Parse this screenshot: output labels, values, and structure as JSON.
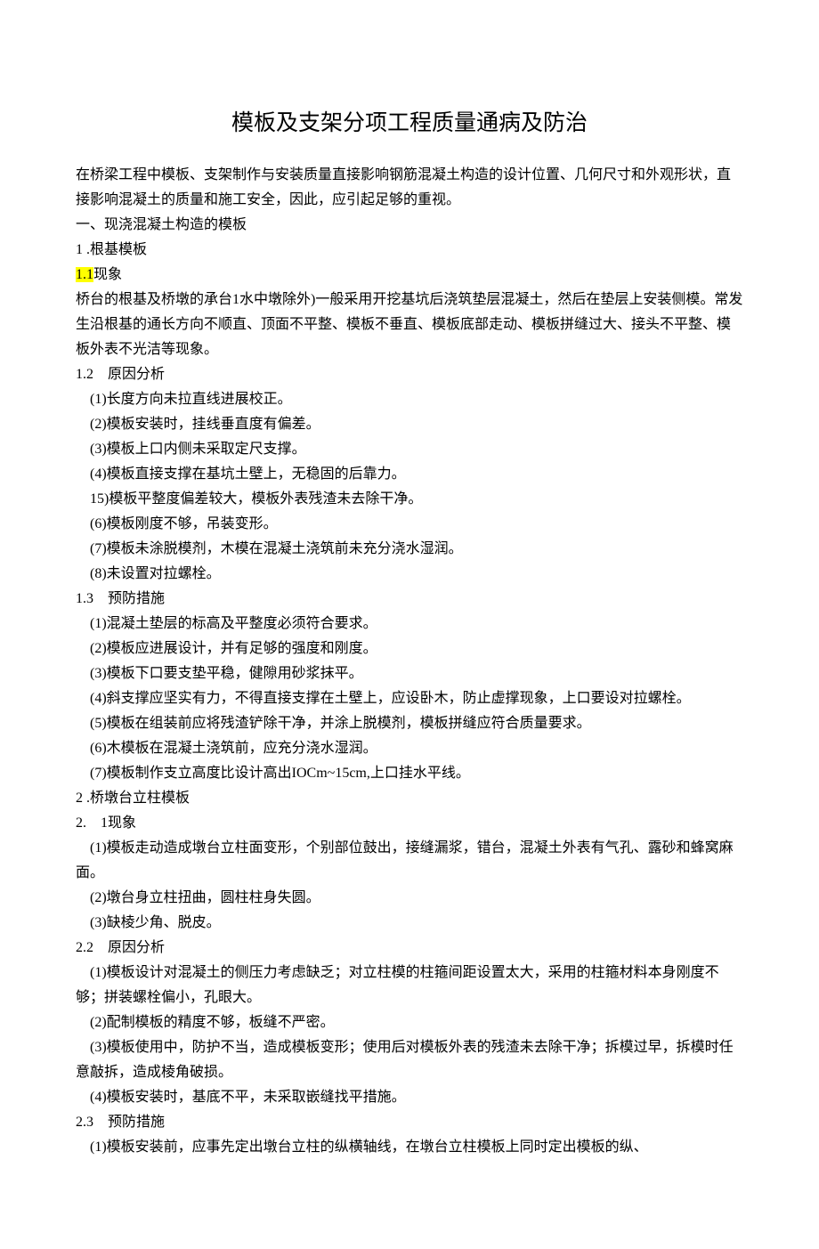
{
  "title": "模板及支架分项工程质量通病及防治",
  "intro": "在桥梁工程中模板、支架制作与安装质量直接影响钢筋混凝土构造的设计位置、几何尺寸和外观形状，直接影响混凝土的质量和施工安全，因此，应引起足够的重视。",
  "s1_heading": "一、现浇混凝土构造的模板",
  "s1_1": "1 .根基模板",
  "s1_1_1": "1.1现象",
  "s1_1_1_p": "桥台的根基及桥墩的承台1水中墩除外)一般采用开挖基坑后浇筑垫层混凝土，然后在垫层上安装侧模。常发生沿根基的通长方向不顺直、顶面不平整、模板不垂直、模板底部走动、模板拼缝过大、接头不平整、模板外表不光洁等现象。",
  "s1_1_2": "1.2　原因分析",
  "s1_1_2_items": [
    "(1)长度方向未拉直线进展校正。",
    "(2)模板安装时，挂线垂直度有偏差。",
    "(3)模板上口内侧未采取定尺支撑。",
    "(4)模板直接支撑在基坑土壁上，无稳固的后靠力。",
    "15)模板平整度偏差较大，模板外表残渣未去除干净。",
    "(6)模板刚度不够，吊装变形。",
    "(7)模板未涂脱模剂，木模在混凝土浇筑前未充分浇水湿润。",
    "(8)未设置对拉螺栓。"
  ],
  "s1_1_3": "1.3　预防措施",
  "s1_1_3_items": [
    "(1)混凝土垫层的标高及平整度必须符合要求。",
    "(2)模板应进展设计，并有足够的强度和刚度。",
    "(3)模板下口要支垫平稳，健隙用砂浆抹平。",
    "(4)斜支撑应坚实有力，不得直接支撑在土壁上，应设卧木，防止虚撑现象，上口要设对拉螺栓。",
    "(5)模板在组装前应将残渣铲除干净，并涂上脱模剂，模板拼缝应符合质量要求。",
    "(6)木模板在混凝土浇筑前，应充分浇水湿润。",
    "(7)模板制作支立高度比设计高出IOCm~15cm,上口挂水平线。"
  ],
  "s2": "2 .桥墩台立柱模板",
  "s2_1": "2.　1现象",
  "s2_1_items": [
    "(1)模板走动造成墩台立柱面变形，个别部位鼓出，接缝漏浆，错台，混凝土外表有气孔、露砂和蜂窝麻面。",
    "(2)墩台身立柱扭曲，圆柱柱身失圆。",
    "(3)缺棱少角、脱皮。"
  ],
  "s2_2": "2.2　原因分析",
  "s2_2_items": [
    "(1)模板设计对混凝土的侧压力考虑缺乏；对立柱模的柱箍间距设置太大，采用的柱箍材料本身刚度不够；拼装螺栓偏小，孔眼大。",
    "(2)配制模板的精度不够，板缝不严密。",
    "(3)模板使用中，防护不当，造成模板变形；使用后对模板外表的残渣未去除干净；拆模过早，拆模时任意敲拆，造成棱角破损。",
    "(4)模板安装时，基底不平，未采取嵌缝找平措施。"
  ],
  "s2_3": "2.3　预防措施",
  "s2_3_items": [
    "(1)模板安装前，应事先定出墩台立柱的纵横轴线，在墩台立柱模板上同时定出模板的纵、"
  ]
}
